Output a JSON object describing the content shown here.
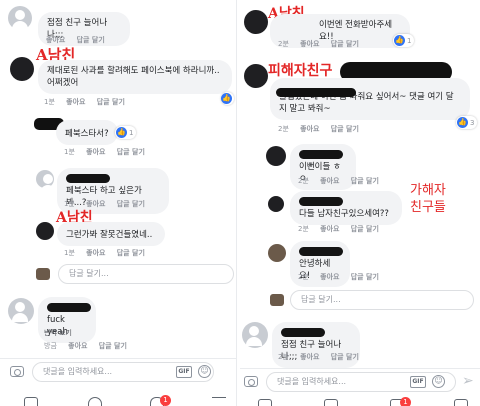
{
  "left": {
    "comments": [
      {
        "text": "점점 친구 늘어나나;;;",
        "meta": [
          "",
          "좋아요",
          "답글 달기"
        ]
      },
      {
        "note": "A남친",
        "text": "제대로된 사과를 할려해도 페이스북에 하라니까..어쩌겠어",
        "meta": [
          "1분",
          "좋아요",
          "답글 달기"
        ]
      },
      {
        "text": "페북스타서?",
        "meta": [
          "1분",
          "좋아요",
          "답글 달기"
        ],
        "likes": "1"
      },
      {
        "text": "페북스타 하고 싶은가봐...?",
        "meta": [
          "1분",
          "좋아요",
          "답글 달기"
        ]
      },
      {
        "note": "A남친",
        "text": "그런가봐 잘못건들였네..",
        "meta": [
          "1분",
          "좋아요",
          "답글 달기"
        ]
      },
      {
        "text": "fuck yeah",
        "translate": "번역 보기",
        "meta": [
          "방금",
          "좋아요",
          "답글 달기"
        ]
      }
    ],
    "reply_placeholder": "답글 달기...",
    "input_placeholder": "댓글을 입력하세요...",
    "gif_label": "GIF",
    "badge": "1"
  },
  "right": {
    "comments": [
      {
        "note": "A남친",
        "text": "이번엔 전화받아주세요!!",
        "meta": [
          "2분",
          "좋아요",
          "답글 달기"
        ],
        "likes": "1"
      },
      {
        "note": "피해자친구",
        "text": "졸업했는데 이건 좀 봐줘요 싶어서~ 댓글 여기 달지 말고 봐줘~",
        "meta": [
          "2분",
          "좋아요",
          "답글 달기"
        ],
        "likes": "3"
      },
      {
        "text": "이뻔이들 ㅎㅇ",
        "meta": [
          "2분",
          "좋아요",
          "답글 달기"
        ]
      },
      {
        "text": "다들 남자친구있으세여??",
        "meta": [
          "2분",
          "좋아요",
          "답글 달기"
        ]
      },
      {
        "text": "안녕하세요!",
        "meta": [
          "2분",
          "좋아요",
          "답글 달기"
        ]
      },
      {
        "text": "점점 친구 늘어나나;;;",
        "meta": [
          "2분",
          "좋아요",
          "답글 달기"
        ]
      }
    ],
    "side_label": "가해자\n친구들",
    "reply_placeholder": "답글 달기...",
    "input_placeholder": "댓글을 입력하세요...",
    "gif_label": "GIF",
    "badge": "1"
  },
  "colors": {
    "like_blue": "#2f73f5",
    "annotation_red": "#e32727",
    "badge_red": "#fa3e3e"
  }
}
